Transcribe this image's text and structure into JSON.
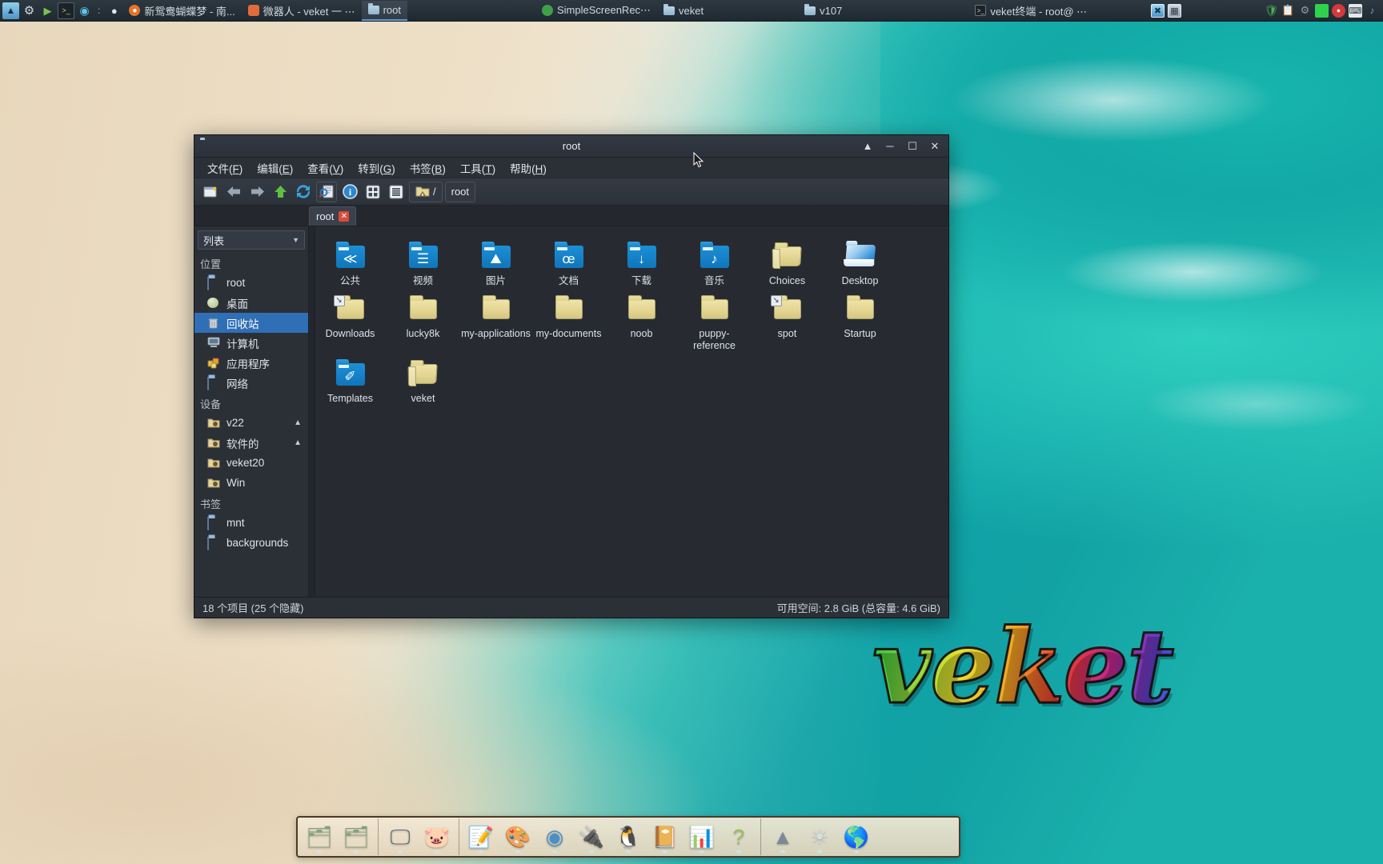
{
  "taskbar": {
    "launchers": [
      {
        "name": "system-monitor-icon",
        "glyph": "░"
      },
      {
        "name": "settings-gear-icon",
        "glyph": "⚙"
      },
      {
        "name": "media-play-icon",
        "glyph": "▶"
      },
      {
        "name": "terminal-icon",
        "glyph": "▤"
      },
      {
        "name": "browser-globe-icon",
        "glyph": "ἱ0"
      }
    ],
    "separator": ":",
    "tasks": [
      {
        "label": "新鸳鸯蝴蝶梦 - 南...",
        "icon": "firefox-icon",
        "active": false
      },
      {
        "label": "微器人 - veket 一 ⋯",
        "icon": "app-icon",
        "active": false
      },
      {
        "label": "root",
        "icon": "folder-icon",
        "active": true
      },
      {
        "label": "SimpleScreenRec⋯",
        "icon": "recorder-icon",
        "active": false
      },
      {
        "label": "veket",
        "icon": "folder-icon",
        "active": false
      },
      {
        "label": "v107",
        "icon": "folder-icon",
        "active": false
      },
      {
        "label": "veket终端 - root@ ⋯",
        "icon": "terminal-icon",
        "active": false
      }
    ],
    "pinned_right": [
      {
        "name": "display-icon",
        "glyph": "❑"
      },
      {
        "name": "file-manager-icon",
        "glyph": "▣"
      }
    ],
    "tray": [
      {
        "name": "shield-icon",
        "color": "#4caf50",
        "glyph": "⛨"
      },
      {
        "name": "clipboard-icon",
        "color": "#e8d98a",
        "glyph": "ὌB"
      },
      {
        "name": "network-icon",
        "color": "#6f7b88",
        "glyph": "⚙"
      },
      {
        "name": "green-square-icon",
        "color": "#2fd24a",
        "glyph": ""
      },
      {
        "name": "power-icon",
        "color": "#d03a3a",
        "glyph": "●"
      },
      {
        "name": "keyboard-icon",
        "color": "#e4e8ec",
        "glyph": "⌨"
      },
      {
        "name": "volume-icon",
        "color": "#7aa8d0",
        "glyph": "♪"
      }
    ]
  },
  "window": {
    "title": "root",
    "title_icon": "folder-icon",
    "controls": {
      "shade": "▲",
      "minimize": "─",
      "maximize": "☐",
      "close": "✕"
    },
    "menu": [
      {
        "label": "文件",
        "accel": "F"
      },
      {
        "label": "编辑",
        "accel": "E"
      },
      {
        "label": "查看",
        "accel": "V"
      },
      {
        "label": "转到",
        "accel": "G"
      },
      {
        "label": "书签",
        "accel": "B"
      },
      {
        "label": "工具",
        "accel": "T"
      },
      {
        "label": "帮助",
        "accel": "H"
      }
    ],
    "toolbar": [
      {
        "name": "new-window-button",
        "glyph": "▧"
      },
      {
        "name": "back-button",
        "glyph": "⬅"
      },
      {
        "name": "forward-button",
        "glyph": "➡"
      },
      {
        "name": "up-button",
        "glyph": "⬆"
      },
      {
        "name": "refresh-button",
        "glyph": "⟳"
      },
      {
        "name": "find-button",
        "glyph": "ὐD"
      },
      {
        "name": "properties-button",
        "glyph": "ⓘ"
      },
      {
        "name": "icon-view-button",
        "glyph": "⊞"
      },
      {
        "name": "list-view-button",
        "glyph": "☰"
      }
    ],
    "path_button": {
      "icon": "home-folder-icon",
      "label": "/"
    },
    "location_button": "root",
    "tab": {
      "label": "root",
      "close": "✕"
    },
    "status_left": "18 个项目 (25 个隐藏)",
    "status_right": "可用空间: 2.8 GiB (总容量: 4.6 GiB)"
  },
  "sidebar": {
    "view_mode": "列表",
    "sections": [
      {
        "title": "位置",
        "items": [
          {
            "label": "root",
            "icon": "folder-blue-icon",
            "type": "blue",
            "selected": false,
            "eject": false
          },
          {
            "label": "桌面",
            "icon": "desktop-icon",
            "type": "desk",
            "selected": false,
            "eject": false
          },
          {
            "label": "回收站",
            "icon": "trash-icon",
            "type": "trash",
            "selected": true,
            "eject": false
          },
          {
            "label": "计算机",
            "icon": "computer-icon",
            "type": "computer",
            "selected": false,
            "eject": false
          },
          {
            "label": "应用程序",
            "icon": "applications-icon",
            "type": "apps",
            "selected": false,
            "eject": false
          },
          {
            "label": "网络",
            "icon": "network-icon",
            "type": "net",
            "selected": false,
            "eject": false
          }
        ]
      },
      {
        "title": "设备",
        "items": [
          {
            "label": "v22",
            "icon": "drive-folder-icon",
            "type": "drive",
            "selected": false,
            "eject": true
          },
          {
            "label": "软件的",
            "icon": "drive-folder-icon",
            "type": "drive",
            "selected": false,
            "eject": true
          },
          {
            "label": "veket20",
            "icon": "drive-folder-icon",
            "type": "drive",
            "selected": false,
            "eject": false
          },
          {
            "label": "Win",
            "icon": "drive-folder-icon",
            "type": "drive",
            "selected": false,
            "eject": false
          }
        ]
      },
      {
        "title": "书签",
        "items": [
          {
            "label": "mnt",
            "icon": "folder-blue-icon",
            "type": "net",
            "selected": false,
            "eject": false
          },
          {
            "label": "backgrounds",
            "icon": "folder-blue-icon",
            "type": "net",
            "selected": false,
            "eject": false
          }
        ]
      }
    ]
  },
  "files": [
    {
      "label": "公共",
      "style": "blue",
      "glyph": "≪",
      "symlink": false
    },
    {
      "label": "视频",
      "style": "blue",
      "glyph": "☰",
      "symlink": false
    },
    {
      "label": "图片",
      "style": "blue",
      "glyph": "⛰",
      "symlink": false
    },
    {
      "label": "文档",
      "style": "blue",
      "glyph": "œ",
      "symlink": false
    },
    {
      "label": "下载",
      "style": "blue",
      "glyph": "↓",
      "symlink": false
    },
    {
      "label": "音乐",
      "style": "blue",
      "glyph": "♪",
      "symlink": false
    },
    {
      "label": "Choices",
      "style": "tan-open",
      "glyph": "",
      "symlink": false
    },
    {
      "label": "Desktop",
      "style": "desk",
      "glyph": "",
      "symlink": false
    },
    {
      "label": "Downloads",
      "style": "tan",
      "glyph": "",
      "symlink": true
    },
    {
      "label": "lucky8k",
      "style": "tan",
      "glyph": "",
      "symlink": false
    },
    {
      "label": "my-applications",
      "style": "tan",
      "glyph": "",
      "symlink": false
    },
    {
      "label": "my-documents",
      "style": "tan",
      "glyph": "",
      "symlink": false
    },
    {
      "label": "noob",
      "style": "tan",
      "glyph": "",
      "symlink": false
    },
    {
      "label": "puppy-reference",
      "style": "tan",
      "glyph": "",
      "symlink": false
    },
    {
      "label": "spot",
      "style": "tan",
      "glyph": "",
      "symlink": true
    },
    {
      "label": "Startup",
      "style": "tan",
      "glyph": "",
      "symlink": false
    },
    {
      "label": "Templates",
      "style": "blue",
      "glyph": "✐",
      "symlink": false
    },
    {
      "label": "veket",
      "style": "tan-open",
      "glyph": "",
      "symlink": false
    }
  ],
  "wordmark": "veket",
  "dock": {
    "groups": [
      [
        {
          "name": "file-manager-icon",
          "glyph": "🗂",
          "color": "#7fa27a"
        },
        {
          "name": "file-manager-2-icon",
          "glyph": "🗂",
          "color": "#7fa27a"
        }
      ],
      [
        {
          "name": "display-settings-icon",
          "glyph": "🖵",
          "color": "#5a6b7a"
        },
        {
          "name": "pig-mascot-icon",
          "glyph": "🐷",
          "color": "#e8a0a8"
        }
      ],
      [
        {
          "name": "text-editor-icon",
          "glyph": "📝",
          "color": "#9fb6cf"
        },
        {
          "name": "paint-palette-icon",
          "glyph": "🎨",
          "color": "#d9b45c"
        },
        {
          "name": "media-player-icon",
          "glyph": "◉",
          "color": "#4a90c4"
        },
        {
          "name": "usb-device-icon",
          "glyph": "🔌",
          "color": "#6fae4f"
        },
        {
          "name": "linux-penguin-icon",
          "glyph": "🐧",
          "color": "#2b2b2b"
        },
        {
          "name": "notebook-icon",
          "glyph": "📔",
          "color": "#c8a52e"
        },
        {
          "name": "office-suite-icon",
          "glyph": "📊",
          "color": "#dfe4ea"
        },
        {
          "name": "help-icon",
          "glyph": "?",
          "color": "#9dbd5b"
        }
      ],
      [
        {
          "name": "network-tool-icon",
          "glyph": "▲",
          "color": "#7b8a96"
        },
        {
          "name": "brightness-icon",
          "glyph": "☀",
          "color": "#d6dde3"
        },
        {
          "name": "web-browser-icon",
          "glyph": "🌎",
          "color": "#3f8f5c"
        }
      ]
    ]
  },
  "colors": {
    "accent": "#2f6fb5",
    "window_bg": "#2b2f36",
    "pane_bg": "#272b31",
    "taskbar_bg": "#26313a",
    "folder_blue": "#1076bb",
    "folder_tan": "#e2d491",
    "tab_close_red": "#d94b3c"
  }
}
